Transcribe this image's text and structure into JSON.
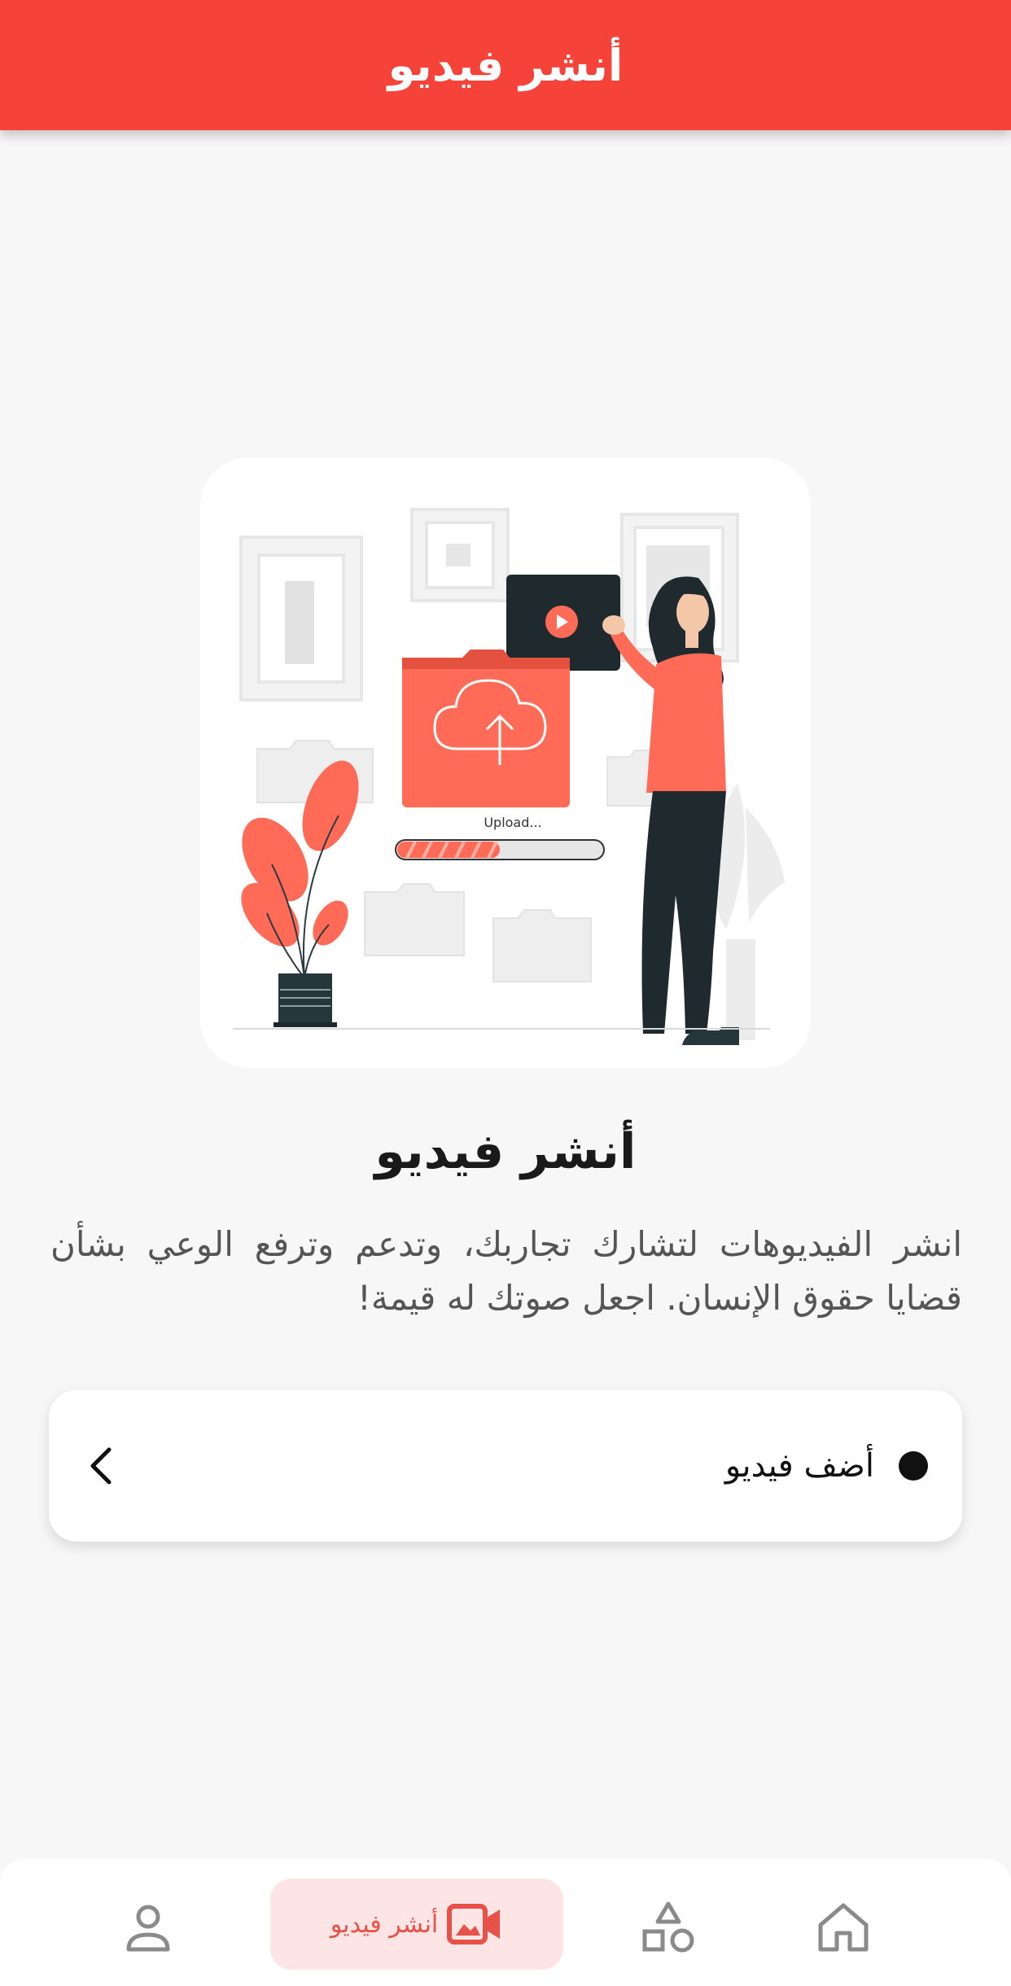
{
  "app_bar": {
    "title": "أنشر فيديو"
  },
  "hero": {
    "illustration_text": "Upload..."
  },
  "content": {
    "headline": "أنشر فيديو",
    "description": "انشر الفيديوهات لتشارك تجاربك، وتدعم وترفع الوعي بشأن قضايا حقوق الإنسان. اجعل صوتك له قيمة!"
  },
  "action": {
    "label": "أضف فيديو",
    "icon": "chevron-left-icon"
  },
  "bottom_nav": {
    "items": [
      {
        "name": "home",
        "icon": "home-icon"
      },
      {
        "name": "categories",
        "icon": "shapes-icon"
      },
      {
        "name": "post-video",
        "icon": "video-icon",
        "label": "أنشر فيديو",
        "selected": true
      },
      {
        "name": "profile",
        "icon": "person-icon"
      }
    ]
  },
  "colors": {
    "primary": "#f5433a",
    "illustration_accent": "#ff6b57",
    "nav_selected_bg": "#fde5e5",
    "background": "#f7f7f7"
  }
}
